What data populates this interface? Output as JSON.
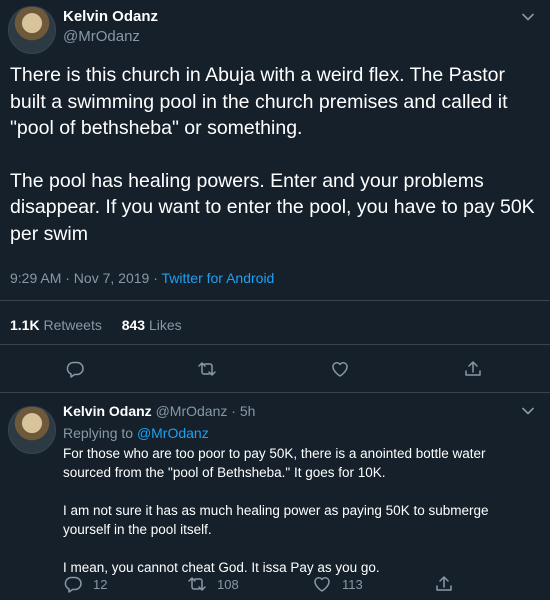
{
  "tweet": {
    "author_name": "Kelvin Odanz",
    "author_handle": "@MrOdanz",
    "paragraphs": [
      "There is this church in Abuja with a weird flex. The Pastor built a swimming pool in the church premises and called it \"pool of bethsheba\" or something.",
      "The pool has healing powers. Enter and your problems disappear. If you want to enter the pool, you have to pay 50K per swim"
    ],
    "timestamp": "9:29 AM · Nov 7, 2019",
    "separator": " · ",
    "source": "Twitter for Android",
    "retweets_count": "1.1K",
    "retweets_label": "Retweets",
    "likes_count": "843",
    "likes_label": "Likes",
    "icons": [
      "reply-icon",
      "retweet-icon",
      "like-icon",
      "share-icon",
      "chevron-down-icon"
    ]
  },
  "reply": {
    "author_name": "Kelvin Odanz",
    "author_handle": "@MrOdanz",
    "time": "· 5h",
    "replying_prefix": "Replying to",
    "replying_handle": "@MrOdanz",
    "paragraphs": [
      "For those who are too poor to pay 50K, there is a anointed bottle water sourced from the \"pool of Bethsheba.\" It goes for 10K.",
      "I am not sure it has as much healing power as paying 50K to submerge yourself in the pool itself.",
      "I mean, you cannot cheat God. It issa Pay as you go."
    ],
    "reply_count": "12",
    "retweet_count": "108",
    "like_count": "113"
  },
  "colors": {
    "background": "#15202b",
    "text": "#ffffff",
    "muted": "#8899a6",
    "link": "#1da1f2",
    "divider": "#38444d"
  }
}
